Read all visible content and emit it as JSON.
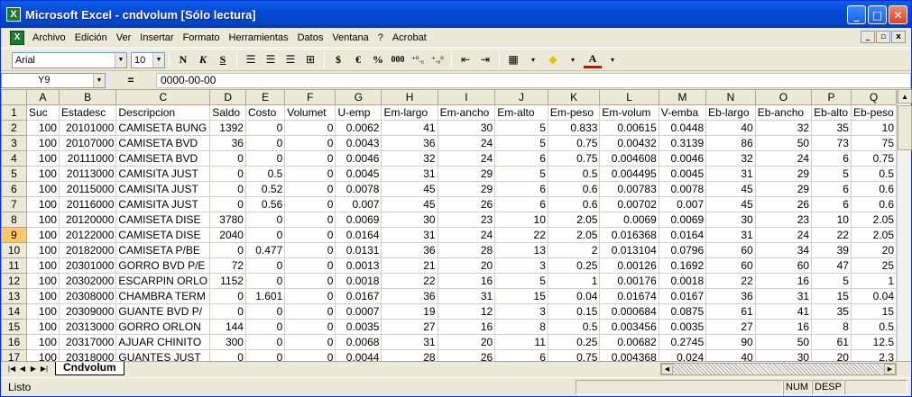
{
  "window": {
    "title": "Microsoft Excel - cndvolum  [Sólo lectura]",
    "app_icon_glyph": "X",
    "controls": {
      "minimize": "_",
      "maximize": "□",
      "close": "✕"
    }
  },
  "menu": {
    "doc_icon_glyph": "X",
    "items": [
      "Archivo",
      "Edición",
      "Ver",
      "Insertar",
      "Formato",
      "Herramientas",
      "Datos",
      "Ventana",
      "?",
      "Acrobat"
    ],
    "mdi_controls": {
      "minimize": "_",
      "restore": "▫",
      "close": "x"
    }
  },
  "toolbar": {
    "font_name": "Arial",
    "font_size": "10",
    "bold": "N",
    "italic": "K",
    "underline": "S",
    "currency": "$",
    "euro": "€",
    "percent": "%",
    "thousands": "000",
    "inc_decimals": "⁺⁰.₀",
    "dec_decimals": "⁺.₀⁰",
    "font_color_letter": "A"
  },
  "formula_bar": {
    "cell_ref": "Y9",
    "equals": "=",
    "value": "0000-00-00"
  },
  "columns": [
    "A",
    "B",
    "C",
    "D",
    "E",
    "F",
    "G",
    "H",
    "I",
    "J",
    "K",
    "L",
    "M",
    "N",
    "O",
    "P",
    "Q"
  ],
  "rows": [
    {
      "n": "1",
      "cells": [
        "Suc",
        "Estadesc",
        "Descripcion",
        "Saldo",
        "Costo",
        "Volumet",
        "U-emp",
        "Em-largo",
        "Em-ancho",
        "Em-alto",
        "Em-peso",
        "Em-volum",
        "V-emba",
        "Eb-largo",
        "Eb-ancho",
        "Eb-alto",
        "Eb-peso"
      ]
    },
    {
      "n": "2",
      "cells": [
        "100",
        "20101000",
        "CAMISETA BUNG",
        "1392",
        "0",
        "0",
        "0.0062",
        "41",
        "30",
        "5",
        "0.833",
        "0.00615",
        "0.0448",
        "40",
        "32",
        "35",
        "10"
      ]
    },
    {
      "n": "3",
      "cells": [
        "100",
        "20107000",
        "CAMISETA BVD",
        "36",
        "0",
        "0",
        "0.0043",
        "36",
        "24",
        "5",
        "0.75",
        "0.00432",
        "0.3139",
        "86",
        "50",
        "73",
        "75"
      ]
    },
    {
      "n": "4",
      "cells": [
        "100",
        "20111000",
        "CAMISETA BVD",
        "0",
        "0",
        "0",
        "0.0046",
        "32",
        "24",
        "6",
        "0.75",
        "0.004608",
        "0.0046",
        "32",
        "24",
        "6",
        "0.75"
      ]
    },
    {
      "n": "5",
      "cells": [
        "100",
        "20113000",
        "CAMISITA JUST",
        "0",
        "0.5",
        "0",
        "0.0045",
        "31",
        "29",
        "5",
        "0.5",
        "0.004495",
        "0.0045",
        "31",
        "29",
        "5",
        "0.5"
      ]
    },
    {
      "n": "6",
      "cells": [
        "100",
        "20115000",
        "CAMISITA JUST",
        "0",
        "0.52",
        "0",
        "0.0078",
        "45",
        "29",
        "6",
        "0.6",
        "0.00783",
        "0.0078",
        "45",
        "29",
        "6",
        "0.6"
      ]
    },
    {
      "n": "7",
      "cells": [
        "100",
        "20116000",
        "CAMISITA JUST",
        "0",
        "0.56",
        "0",
        "0.007",
        "45",
        "26",
        "6",
        "0.6",
        "0.00702",
        "0.007",
        "45",
        "26",
        "6",
        "0.6"
      ]
    },
    {
      "n": "8",
      "cells": [
        "100",
        "20120000",
        "CAMISETA DISE",
        "3780",
        "0",
        "0",
        "0.0069",
        "30",
        "23",
        "10",
        "2.05",
        "0.0069",
        "0.0069",
        "30",
        "23",
        "10",
        "2.05"
      ]
    },
    {
      "n": "9",
      "cells": [
        "100",
        "20122000",
        "CAMISETA DISE",
        "2040",
        "0",
        "0",
        "0.0164",
        "31",
        "24",
        "22",
        "2.05",
        "0.016368",
        "0.0164",
        "31",
        "24",
        "22",
        "2.05"
      ]
    },
    {
      "n": "10",
      "cells": [
        "100",
        "20182000",
        "CAMISETA P/BE",
        "0",
        "0.477",
        "0",
        "0.0131",
        "36",
        "28",
        "13",
        "2",
        "0.013104",
        "0.0796",
        "60",
        "34",
        "39",
        "20"
      ]
    },
    {
      "n": "11",
      "cells": [
        "100",
        "20301000",
        "GORRO BVD P/E",
        "72",
        "0",
        "0",
        "0.0013",
        "21",
        "20",
        "3",
        "0.25",
        "0.00126",
        "0.1692",
        "60",
        "60",
        "47",
        "25"
      ]
    },
    {
      "n": "12",
      "cells": [
        "100",
        "20302000",
        "ESCARPIN ORLO",
        "1152",
        "0",
        "0",
        "0.0018",
        "22",
        "16",
        "5",
        "1",
        "0.00176",
        "0.0018",
        "22",
        "16",
        "5",
        "1"
      ]
    },
    {
      "n": "13",
      "cells": [
        "100",
        "20308000",
        "CHAMBRA TERM",
        "0",
        "1.601",
        "0",
        "0.0167",
        "36",
        "31",
        "15",
        "0.04",
        "0.01674",
        "0.0167",
        "36",
        "31",
        "15",
        "0.04"
      ]
    },
    {
      "n": "14",
      "cells": [
        "100",
        "20309000",
        "GUANTE BVD P/",
        "0",
        "0",
        "0",
        "0.0007",
        "19",
        "12",
        "3",
        "0.15",
        "0.000684",
        "0.0875",
        "61",
        "41",
        "35",
        "15"
      ]
    },
    {
      "n": "15",
      "cells": [
        "100",
        "20313000",
        "GORRO ORLON",
        "144",
        "0",
        "0",
        "0.0035",
        "27",
        "16",
        "8",
        "0.5",
        "0.003456",
        "0.0035",
        "27",
        "16",
        "8",
        "0.5"
      ]
    },
    {
      "n": "16",
      "cells": [
        "100",
        "20317000",
        "AJUAR CHINITO",
        "300",
        "0",
        "0",
        "0.0068",
        "31",
        "20",
        "11",
        "0.25",
        "0.00682",
        "0.2745",
        "90",
        "50",
        "61",
        "12.5"
      ]
    },
    {
      "n": "17",
      "cells": [
        "100",
        "20318000",
        "GUANTES JUST",
        "0",
        "0",
        "0",
        "0.0044",
        "28",
        "26",
        "6",
        "0.75",
        "0.004368",
        "0.024",
        "40",
        "30",
        "20",
        "2.3"
      ]
    }
  ],
  "selected_row": "9",
  "sheet_tab": "Cndvolum",
  "status": {
    "text": "Listo",
    "num": "NUM",
    "desp": "DESP"
  }
}
